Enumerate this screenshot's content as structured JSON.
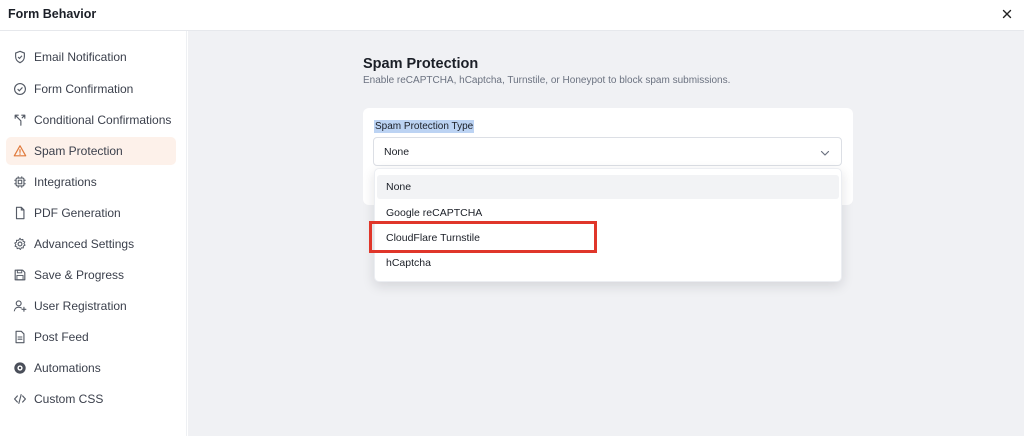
{
  "window": {
    "title": "Form Behavior"
  },
  "sidebar": {
    "items": [
      {
        "label": "Email Notification",
        "icon": "shield-icon"
      },
      {
        "label": "Form Confirmation",
        "icon": "check-circle-icon"
      },
      {
        "label": "Conditional Confirmations",
        "icon": "branch-icon"
      },
      {
        "label": "Spam Protection",
        "icon": "warning-triangle-icon",
        "active": true
      },
      {
        "label": "Integrations",
        "icon": "chip-icon"
      },
      {
        "label": "PDF Generation",
        "icon": "file-icon"
      },
      {
        "label": "Advanced Settings",
        "icon": "gear-icon"
      },
      {
        "label": "Save & Progress",
        "icon": "floppy-disk-icon"
      },
      {
        "label": "User Registration",
        "icon": "user-plus-icon"
      },
      {
        "label": "Post Feed",
        "icon": "document-icon"
      },
      {
        "label": "Automations",
        "icon": "automation-icon"
      },
      {
        "label": "Custom CSS",
        "icon": "code-icon"
      }
    ]
  },
  "main": {
    "title": "Spam Protection",
    "description": "Enable reCAPTCHA, hCaptcha, Turnstile, or Honeypot to block spam submissions.",
    "field_label": "Spam Protection Type",
    "selected_value": "None",
    "options": [
      "None",
      "Google reCAPTCHA",
      "CloudFlare Turnstile",
      "hCaptcha"
    ]
  },
  "colors": {
    "accent": "#e07a3c",
    "active_bg": "#fdf1ea",
    "highlight_border": "#e0362a",
    "label_selection": "#bcd3f3"
  }
}
